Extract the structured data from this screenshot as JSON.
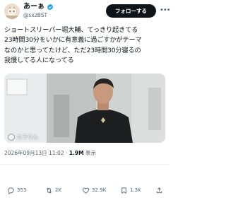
{
  "author": {
    "display_name": "あーぁ",
    "handle": "@sxzBST"
  },
  "follow_button_label": "フォローする",
  "tweet_lines": [
    "ショートスリーパー堀大輔、てっきり起きてる",
    "23時間30分をいかに有意義に過ごすかがテーマ",
    "なのかと思ってたけど、ただ23時間30分寝るの",
    "我慢してる人になってる"
  ],
  "media": {
    "watermark": "たうりん"
  },
  "meta": {
    "datetime": "2026年09月13日 11:02",
    "separator": "·",
    "views_count": "1.9M",
    "views_label": "表示"
  },
  "actions": {
    "reply_count": "353",
    "retweet_count": "2K",
    "like_count": "32.9K",
    "bookmark_count": "1.3K"
  },
  "colors": {
    "text": "#0f1419",
    "secondary": "#536471",
    "verified": "#1d9bf0"
  }
}
